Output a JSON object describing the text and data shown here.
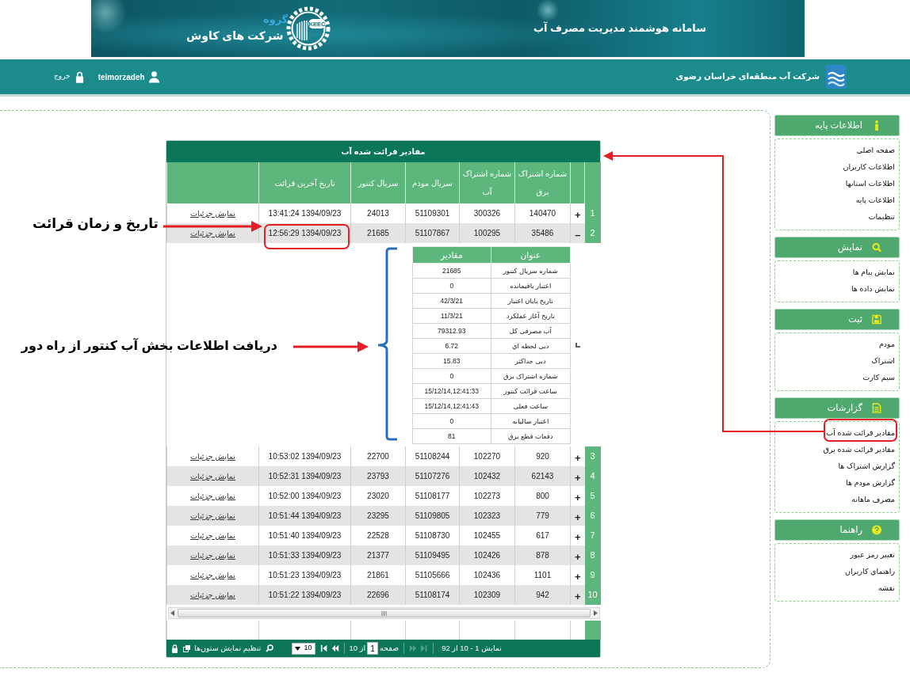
{
  "banner": {
    "title": "سامانه هوشمند مدیریت مصرف آب",
    "group_label": "گروه",
    "company": "شرکت های کاوش",
    "logo_mark": "KEEC"
  },
  "navbar": {
    "organization": "شرکت آب منطقه‌ای خراسان رضوی",
    "user": "teimorzadeh",
    "logout": "خروج"
  },
  "sidebar": [
    {
      "title": "اطلاعات پایه",
      "items": [
        {
          "label": "صفحه اصلی",
          "selected": false
        },
        {
          "label": "اطلاعات کاربران",
          "selected": false
        },
        {
          "label": "اطلاعات استانها",
          "selected": false
        },
        {
          "label": "اطلاعات پایه",
          "selected": false
        },
        {
          "label": "تنظیمات",
          "selected": false
        }
      ]
    },
    {
      "title": "نمایش",
      "items": [
        {
          "label": "نمایش پیام ها",
          "selected": false
        },
        {
          "label": "نمایش داده ها",
          "selected": false
        }
      ]
    },
    {
      "title": "ثبت",
      "items": [
        {
          "label": "مودم",
          "selected": false
        },
        {
          "label": "اشتراک",
          "selected": false
        },
        {
          "label": "سیم کارت",
          "selected": false
        }
      ]
    },
    {
      "title": "گزارشات",
      "items": [
        {
          "label": "مقادیر قرائت شده آب",
          "selected": false
        },
        {
          "label": "مقادیر قرائت شده برق",
          "selected": false
        },
        {
          "label": "گزارش اشتراک ها",
          "selected": false
        },
        {
          "label": "گزارش مودم ها",
          "selected": false
        },
        {
          "label": "مصرف ماهانه",
          "selected": false
        }
      ]
    },
    {
      "title": "راهنما",
      "items": [
        {
          "label": "تغییر رمز عبور",
          "selected": false
        },
        {
          "label": "راهنمای کاربران",
          "selected": false
        },
        {
          "label": "نقشه",
          "selected": false
        }
      ]
    }
  ],
  "table": {
    "title": "مقادیر قرائت شده آب",
    "columns": [
      "شماره اشتراک برق",
      "شماره اشتراک آب",
      "سریال مودم",
      "سریال کنتور",
      "تاریخ آخرین قرائت"
    ],
    "rows": [
      {
        "number": "1",
        "toggle": "+",
        "cells": [
          "140470",
          "300326",
          "51109301",
          "24013",
          "13:41:24 1394/09/23"
        ],
        "link": "نمایش جزئیات"
      },
      {
        "number": "2",
        "toggle": "–",
        "cells": [
          "35486",
          "100295",
          "51107867",
          "21685",
          "12:56:29 1394/09/23"
        ],
        "link": "نمایش جزئیات",
        "details": {
          "columns": [
            "عنوان",
            "مقادیر"
          ],
          "rows": [
            {
              "title": "شماره سریال کنتور",
              "value": "21685"
            },
            {
              "title": "اعتبار باقیمانده",
              "value": "0"
            },
            {
              "title": "تاریخ پایان اعتبار",
              "value": "42/3/21"
            },
            {
              "title": "تاریخ آغاز عملکرد",
              "value": "11/3/21"
            },
            {
              "title": "آب مصرفی کل",
              "value": "79312.93"
            },
            {
              "title": "دبی لحظه اي",
              "value": "6.72"
            },
            {
              "title": "دبی حداکثر",
              "value": "15.83"
            },
            {
              "title": "شماره اشتراک برق",
              "value": "0"
            },
            {
              "title": "ساعت قرائت کنتور",
              "value": "15/12/14,12:41:33"
            },
            {
              "title": "ساعت فعلی",
              "value": "15/12/14,12:41:43"
            },
            {
              "title": "اعتبار سالیانه",
              "value": "0"
            },
            {
              "title": "دفعات قطع برق",
              "value": "81"
            }
          ]
        }
      },
      {
        "number": "3",
        "toggle": "+",
        "cells": [
          "920",
          "102270",
          "51108244",
          "22700",
          "10:53:02 1394/09/23"
        ],
        "link": "نمایش جزئیات"
      },
      {
        "number": "4",
        "toggle": "+",
        "cells": [
          "62143",
          "102432",
          "51107276",
          "23793",
          "10:52:31 1394/09/23"
        ],
        "link": "نمایش جزئیات"
      },
      {
        "number": "5",
        "toggle": "+",
        "cells": [
          "800",
          "102273",
          "51108177",
          "23020",
          "10:52:00 1394/09/23"
        ],
        "link": "نمایش جزئیات"
      },
      {
        "number": "6",
        "toggle": "+",
        "cells": [
          "779",
          "102323",
          "51109805",
          "23295",
          "10:51:44 1394/09/23"
        ],
        "link": "نمایش جزئیات"
      },
      {
        "number": "7",
        "toggle": "+",
        "cells": [
          "617",
          "102455",
          "51108730",
          "22528",
          "10:51:40 1394/09/23"
        ],
        "link": "نمایش جزئیات"
      },
      {
        "number": "8",
        "toggle": "+",
        "cells": [
          "878",
          "102426",
          "51109495",
          "21377",
          "10:51:33 1394/09/23"
        ],
        "link": "نمایش جزئیات"
      },
      {
        "number": "9",
        "toggle": "+",
        "cells": [
          "1101",
          "102436",
          "51105666",
          "21861",
          "10:51:23 1394/09/23"
        ],
        "link": "نمایش جزئیات"
      },
      {
        "number": "10",
        "toggle": "+",
        "cells": [
          "942",
          "102309",
          "51108174",
          "22696",
          "10:51:22 1394/09/23"
        ],
        "link": "نمایش جزئیات"
      }
    ]
  },
  "pager": {
    "summary": "نمایش 1 - 10 از 92",
    "back_buttons": [
      {
        "kind": "first",
        "disabled": true
      },
      {
        "kind": "prev",
        "disabled": true
      }
    ],
    "page_label": "صفحه",
    "page": "1",
    "page_count": "از 10",
    "forward_buttons": [
      {
        "kind": "next",
        "disabled": false
      },
      {
        "kind": "last",
        "disabled": false
      }
    ],
    "page_size": "10",
    "columns_label": "تنظیم نمایش ستون‌ها"
  },
  "annotations": [
    {
      "text": "تاریخ و زمان قرائت"
    },
    {
      "text": "دریافت اطلاعات بخش آب کنتور از راه دور"
    }
  ]
}
